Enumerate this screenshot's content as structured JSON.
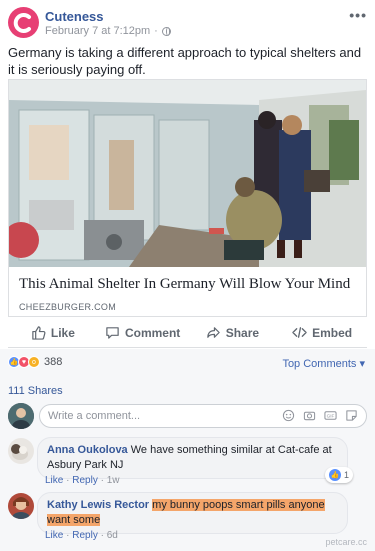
{
  "post": {
    "page_name": "Cuteness",
    "timestamp": "February 7 at 7:12pm",
    "privacy_sep": "·",
    "more": "•••",
    "text": "Germany is taking a different approach to typical shelters and it is seriously paying off."
  },
  "link": {
    "title": "This Animal Shelter In Germany Will Blow Your Mind",
    "domain": "CHEEZBURGER.COM"
  },
  "actions": {
    "like": "Like",
    "comment": "Comment",
    "share": "Share",
    "embed": "Embed"
  },
  "stats": {
    "reaction_count": "388",
    "top_comments": "Top Comments ▾",
    "shares": "111 Shares"
  },
  "composer": {
    "placeholder": "Write a comment..."
  },
  "comments": [
    {
      "author": "Anna Oukolova",
      "text": "We have something similar at Cat-cafe at Asbury Park NJ",
      "like": "Like",
      "reply": "Reply",
      "age": "1w",
      "sep": "·",
      "likes": "1"
    },
    {
      "author": "Kathy Lewis Rector",
      "text": "my bunny poops smart pills anyone want some",
      "like": "Like",
      "reply": "Reply",
      "age": "6d",
      "sep": "·"
    }
  ],
  "watermark": "petcare.cc",
  "colors": {
    "brand_pink": "#e73f74",
    "link_blue": "#365899",
    "highlight": "#f4a56a"
  }
}
